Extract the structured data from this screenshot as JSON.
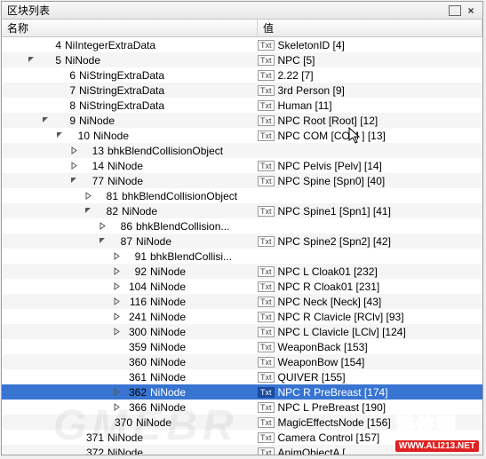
{
  "window": {
    "title": "区块列表",
    "restore_icon": "restore-icon",
    "close_label": "×"
  },
  "columns": {
    "name": "名称",
    "value": "值"
  },
  "tag_label": "Txt",
  "rows": [
    {
      "indent": 0,
      "expander": "none",
      "id": "4",
      "label": "NiIntegerExtraData",
      "value": "SkeletonID [4]"
    },
    {
      "indent": 0,
      "expander": "open",
      "id": "5",
      "label": "NiNode",
      "value": "NPC [5]"
    },
    {
      "indent": 1,
      "expander": "none",
      "id": "6",
      "label": "NiStringExtraData",
      "value": "2.22 [7]"
    },
    {
      "indent": 1,
      "expander": "none",
      "id": "7",
      "label": "NiStringExtraData",
      "value": "3rd Person [9]"
    },
    {
      "indent": 1,
      "expander": "none",
      "id": "8",
      "label": "NiStringExtraData",
      "value": "Human [11]"
    },
    {
      "indent": 1,
      "expander": "open",
      "id": "9",
      "label": "NiNode",
      "value": "NPC Root [Root] [12]"
    },
    {
      "indent": 2,
      "expander": "open",
      "id": "10",
      "label": "NiNode",
      "value": "NPC COM [COM ] [13]"
    },
    {
      "indent": 3,
      "expander": "closed",
      "id": "13",
      "label": "bhkBlendCollisionObject",
      "value": ""
    },
    {
      "indent": 3,
      "expander": "closed",
      "id": "14",
      "label": "NiNode",
      "value": "NPC Pelvis [Pelv] [14]"
    },
    {
      "indent": 3,
      "expander": "open",
      "id": "77",
      "label": "NiNode",
      "value": "NPC Spine [Spn0] [40]"
    },
    {
      "indent": 4,
      "expander": "closed",
      "id": "81",
      "label": "bhkBlendCollisionObject",
      "value": ""
    },
    {
      "indent": 4,
      "expander": "open",
      "id": "82",
      "label": "NiNode",
      "value": "NPC Spine1 [Spn1] [41]"
    },
    {
      "indent": 5,
      "expander": "closed",
      "id": "86",
      "label": "bhkBlendCollision...",
      "value": ""
    },
    {
      "indent": 5,
      "expander": "open",
      "id": "87",
      "label": "NiNode",
      "value": "NPC Spine2 [Spn2] [42]"
    },
    {
      "indent": 6,
      "expander": "closed",
      "id": "91",
      "label": "bhkBlendCollisi...",
      "value": ""
    },
    {
      "indent": 6,
      "expander": "closed",
      "id": "92",
      "label": "NiNode",
      "value": "NPC L Cloak01 [232]"
    },
    {
      "indent": 6,
      "expander": "closed",
      "id": "104",
      "label": "NiNode",
      "value": "NPC R Cloak01 [231]"
    },
    {
      "indent": 6,
      "expander": "closed",
      "id": "116",
      "label": "NiNode",
      "value": "NPC Neck [Neck] [43]"
    },
    {
      "indent": 6,
      "expander": "closed",
      "id": "241",
      "label": "NiNode",
      "value": "NPC R Clavicle [RClv] [93]"
    },
    {
      "indent": 6,
      "expander": "closed",
      "id": "300",
      "label": "NiNode",
      "value": "NPC L Clavicle [LClv] [124]"
    },
    {
      "indent": 6,
      "expander": "none",
      "id": "359",
      "label": "NiNode",
      "value": "WeaponBack [153]"
    },
    {
      "indent": 6,
      "expander": "none",
      "id": "360",
      "label": "NiNode",
      "value": "WeaponBow [154]"
    },
    {
      "indent": 6,
      "expander": "none",
      "id": "361",
      "label": "NiNode",
      "value": "QUIVER [155]"
    },
    {
      "indent": 6,
      "expander": "closed",
      "id": "362",
      "label": "NiNode",
      "value": "NPC R PreBreast [174]",
      "selected": true
    },
    {
      "indent": 6,
      "expander": "closed",
      "id": "366",
      "label": "NiNode",
      "value": "NPC L PreBreast [190]"
    },
    {
      "indent": 5,
      "expander": "none",
      "id": "370",
      "label": "NiNode",
      "value": "MagicEffectsNode [156]"
    },
    {
      "indent": 3,
      "expander": "none",
      "id": "371",
      "label": "NiNode",
      "value": "Camera Control [157]"
    },
    {
      "indent": 3,
      "expander": "none",
      "id": "372",
      "label": "NiNode",
      "value": "AnimObjectA ["
    }
  ],
  "watermark": {
    "brand_cn": "游侠网",
    "brand_url": "WWW.ALI213.NET",
    "faded": "GMEBR"
  }
}
